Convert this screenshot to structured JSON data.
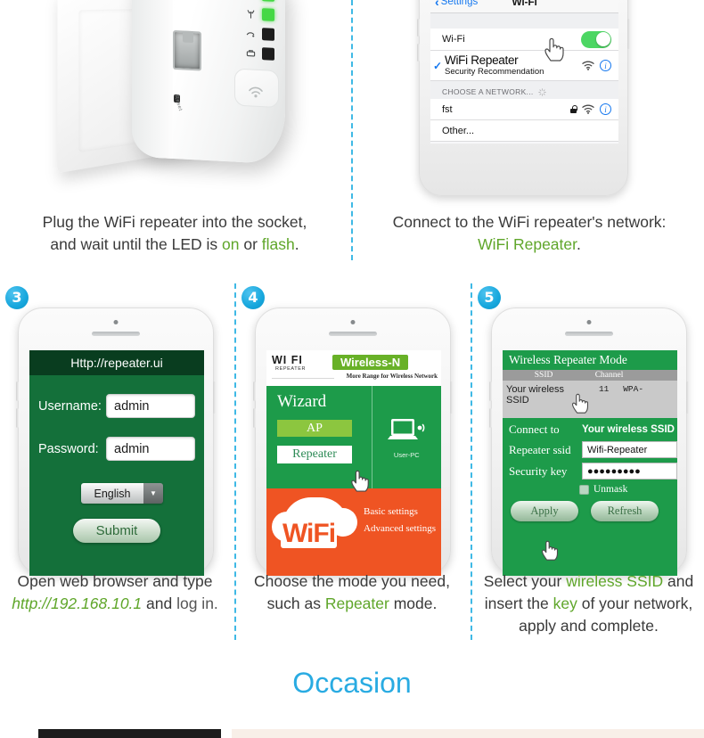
{
  "steps": [
    {
      "number": "",
      "caption_lines": [
        [
          {
            "t": "Plug the WiFi repeater into the socket,",
            "s": "normal"
          }
        ],
        [
          {
            "t": "and wait until the LED is ",
            "s": "normal"
          },
          {
            "t": "on",
            "s": "green"
          },
          {
            "t": " or ",
            "s": "normal"
          },
          {
            "t": "flash",
            "s": "green"
          },
          {
            "t": ".",
            "s": "normal"
          }
        ]
      ]
    },
    {
      "number": "",
      "caption_lines": [
        [
          {
            "t": "Connect to the WiFi repeater's network:",
            "s": "normal"
          }
        ],
        [
          {
            "t": "WiFi Repeater",
            "s": "green"
          },
          {
            "t": ".",
            "s": "normal"
          }
        ]
      ]
    },
    {
      "number": "3",
      "caption_lines": [
        [
          {
            "t": "Open web browser and type",
            "s": "normal"
          }
        ],
        [
          {
            "t": "http://192.168.10.1",
            "s": "url"
          },
          {
            "t": " and ",
            "s": "normal"
          },
          {
            "t": "log in.",
            "s": "dim"
          }
        ]
      ]
    },
    {
      "number": "4",
      "caption_lines": [
        [
          {
            "t": "Choose the mode you need,",
            "s": "normal"
          }
        ],
        [
          {
            "t": "such as ",
            "s": "normal"
          },
          {
            "t": "Repeater",
            "s": "green"
          },
          {
            "t": " mode.",
            "s": "normal"
          }
        ]
      ]
    },
    {
      "number": "5",
      "caption_lines": [
        [
          {
            "t": "Select your ",
            "s": "normal"
          },
          {
            "t": "wireless SSID",
            "s": "green"
          },
          {
            "t": " and",
            "s": "normal"
          }
        ],
        [
          {
            "t": "insert the ",
            "s": "normal"
          },
          {
            "t": "key",
            "s": "green"
          },
          {
            "t": " of your network,",
            "s": "normal"
          }
        ],
        [
          {
            "t": "apply and complete.",
            "s": "normal"
          }
        ]
      ]
    }
  ],
  "caption1_line1": "Plug the WiFi repeater into the socket,",
  "caption1_l2a": "and wait until the LED is ",
  "caption1_on": "on",
  "caption1_or": " or ",
  "caption1_flash": "flash",
  "caption1_dot": ".",
  "caption2_line1": "Connect to the WiFi repeater's network:",
  "caption2_green": "WiFi Repeater",
  "caption2_dot": ".",
  "caption3_line1": "Open web browser and type",
  "caption3_url": "http://192.168.10.1",
  "caption3_mid": " and ",
  "caption3_end": "log in.",
  "caption4_line1": "Choose the mode you need,",
  "caption4_a": "such as ",
  "caption4_green": "Repeater",
  "caption4_b": " mode.",
  "caption5_a": "Select your ",
  "caption5_g1": "wireless SSID",
  "caption5_b": " and",
  "caption5_c": "insert the ",
  "caption5_g2": "key",
  "caption5_d": " of your network,",
  "caption5_e": "apply and complete.",
  "badges": {
    "three": "3",
    "four": "4",
    "five": "5"
  },
  "device": {
    "reset_label": "Reset",
    "leds": [
      {
        "name": "power-led",
        "state": "on"
      },
      {
        "name": "wifi-led",
        "state": "on"
      },
      {
        "name": "wps-led",
        "state": "off"
      },
      {
        "name": "lan-led",
        "state": "off"
      }
    ]
  },
  "ios": {
    "back_label": "Settings",
    "title": "Wi-Fi",
    "wifi_row_label": "Wi-Fi",
    "wifi_toggle": "on",
    "connected_network": "WiFi Repeater",
    "connected_sub": "Security Recommendation",
    "section_header": "CHOOSE A NETWORK...",
    "networks": [
      {
        "name": "fst",
        "secured": true
      },
      {
        "name": "Other...",
        "secured": false
      }
    ]
  },
  "login": {
    "url_bar": "Http://repeater.ui",
    "username_label": "Username:",
    "username_value": "admin",
    "password_label": "Password:",
    "password_value": "admin",
    "language_value": "English",
    "submit_label": "Submit"
  },
  "wizard": {
    "logo_text": "WI FI",
    "logo_sub": "REPEATER",
    "badge": "Wireless-N",
    "tagline": "More Range for Wireless Network",
    "heading": "Wizard",
    "ap_label": "AP",
    "repeater_label": "Repeater",
    "pc_label": "User-PC",
    "wifi_word": "WiFi",
    "basic_settings": "Basic settings",
    "advanced_settings": "Advanced settings"
  },
  "repeater": {
    "title": "Wireless Repeater Mode",
    "columns": [
      "SSID",
      "Channel",
      ""
    ],
    "row": {
      "ssid": "Your wireless SSID",
      "channel": "11",
      "security": "WPA-"
    },
    "connect_to_label": "Connect to",
    "connect_to_value": "Your wireless SSID",
    "repeater_ssid_label": "Repeater ssid",
    "repeater_ssid_value": "Wifi-Repeater",
    "security_key_label": "Security key",
    "security_key_value": "●●●●●●●●●",
    "unmask_label": "Unmask",
    "apply_label": "Apply",
    "refresh_label": "Refresh"
  },
  "occasion_heading": "Occasion",
  "colors": {
    "accent_blue": "#29abe2",
    "green_text": "#5fa62a",
    "panel_green": "#1d9b4a",
    "orange": "#ef5423",
    "badge_green": "#68b127",
    "ios_blue": "#1477ef"
  }
}
